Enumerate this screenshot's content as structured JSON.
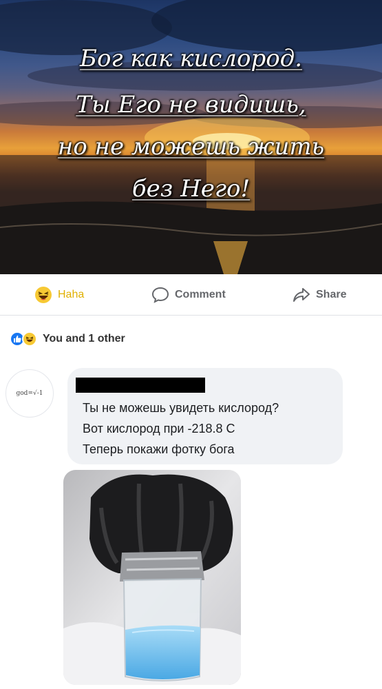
{
  "post": {
    "quote_lines": [
      "Бог как кислород.",
      "Ты Его не видишь,",
      "но не можешь жить",
      "без Него!"
    ]
  },
  "actions": {
    "haha_label": "Haha",
    "comment_label": "Comment",
    "share_label": "Share",
    "haha_icon": "haha-emoji-icon",
    "comment_icon": "speech-bubble-icon",
    "share_icon": "share-arrow-icon"
  },
  "reactions": {
    "summary": "You and 1 other",
    "icons": [
      "like-icon",
      "haha-icon"
    ]
  },
  "comment": {
    "avatar_text": "god=√-1",
    "lines": [
      "Ты не можешь увидеть кислород?",
      "Вот кислород при -218.8 С",
      "Теперь покажи фотку бога"
    ]
  },
  "colors": {
    "haha_yellow": "#e0b000",
    "action_gray": "#65676b",
    "bubble_bg": "#f0f2f5",
    "like_blue": "#1877f2",
    "oxygen_blue": "#7fc4ee"
  }
}
